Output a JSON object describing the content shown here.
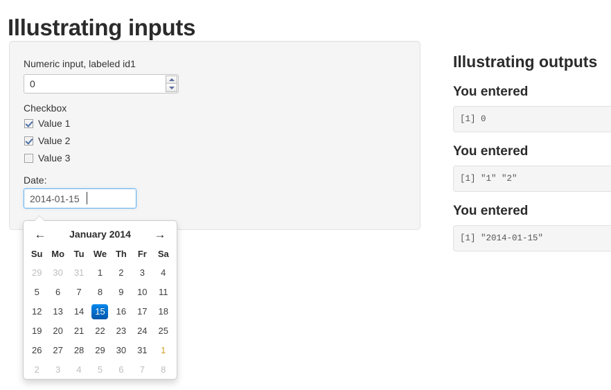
{
  "page": {
    "title": "Illustrating inputs"
  },
  "inputs_panel": {
    "numeric": {
      "label": "Numeric input, labeled id1",
      "value": "0",
      "placeholder": "",
      "spinner_up_icon": "triangle-up-icon",
      "spinner_down_icon": "triangle-down-icon"
    },
    "checkbox_group": {
      "label": "Checkbox",
      "options": [
        {
          "label": "Value 1",
          "checked": true
        },
        {
          "label": "Value 2",
          "checked": true
        },
        {
          "label": "Value 3",
          "checked": false
        }
      ]
    },
    "date": {
      "label": "Date:",
      "value": "2014-01-15",
      "placeholder": "yyyy-mm-dd",
      "focused": true
    }
  },
  "datepicker": {
    "prev_icon": "←",
    "next_icon": "→",
    "month_title": "January 2014",
    "weekdays": [
      "Su",
      "Mo",
      "Tu",
      "We",
      "Th",
      "Fr",
      "Sa"
    ],
    "selected_day": 15,
    "accent_color": "#0073dd",
    "weeks": [
      [
        {
          "d": "29",
          "state": "old"
        },
        {
          "d": "30",
          "state": "old"
        },
        {
          "d": "31",
          "state": "old"
        },
        {
          "d": "1",
          "state": "cur"
        },
        {
          "d": "2",
          "state": "cur"
        },
        {
          "d": "3",
          "state": "cur"
        },
        {
          "d": "4",
          "state": "cur"
        }
      ],
      [
        {
          "d": "5",
          "state": "cur"
        },
        {
          "d": "6",
          "state": "cur"
        },
        {
          "d": "7",
          "state": "cur"
        },
        {
          "d": "8",
          "state": "cur"
        },
        {
          "d": "9",
          "state": "cur"
        },
        {
          "d": "10",
          "state": "cur"
        },
        {
          "d": "11",
          "state": "cur"
        }
      ],
      [
        {
          "d": "12",
          "state": "cur"
        },
        {
          "d": "13",
          "state": "cur"
        },
        {
          "d": "14",
          "state": "cur"
        },
        {
          "d": "15",
          "state": "active"
        },
        {
          "d": "16",
          "state": "cur"
        },
        {
          "d": "17",
          "state": "cur"
        },
        {
          "d": "18",
          "state": "cur"
        }
      ],
      [
        {
          "d": "19",
          "state": "cur"
        },
        {
          "d": "20",
          "state": "cur"
        },
        {
          "d": "21",
          "state": "cur"
        },
        {
          "d": "22",
          "state": "cur"
        },
        {
          "d": "23",
          "state": "cur"
        },
        {
          "d": "24",
          "state": "cur"
        },
        {
          "d": "25",
          "state": "cur"
        }
      ],
      [
        {
          "d": "26",
          "state": "cur"
        },
        {
          "d": "27",
          "state": "cur"
        },
        {
          "d": "28",
          "state": "cur"
        },
        {
          "d": "29",
          "state": "cur"
        },
        {
          "d": "30",
          "state": "cur"
        },
        {
          "d": "31",
          "state": "cur"
        },
        {
          "d": "1",
          "state": "new1"
        }
      ],
      [
        {
          "d": "2",
          "state": "new"
        },
        {
          "d": "3",
          "state": "new"
        },
        {
          "d": "4",
          "state": "new"
        },
        {
          "d": "5",
          "state": "new"
        },
        {
          "d": "6",
          "state": "new"
        },
        {
          "d": "7",
          "state": "new"
        },
        {
          "d": "8",
          "state": "new"
        }
      ]
    ]
  },
  "outputs_panel": {
    "title": "Illustrating outputs",
    "blocks": [
      {
        "heading": "You entered",
        "text": "[1] 0"
      },
      {
        "heading": "You entered",
        "text": "[1] \"1\" \"2\""
      },
      {
        "heading": "You entered",
        "text": "[1] \"2014-01-15\""
      }
    ]
  }
}
